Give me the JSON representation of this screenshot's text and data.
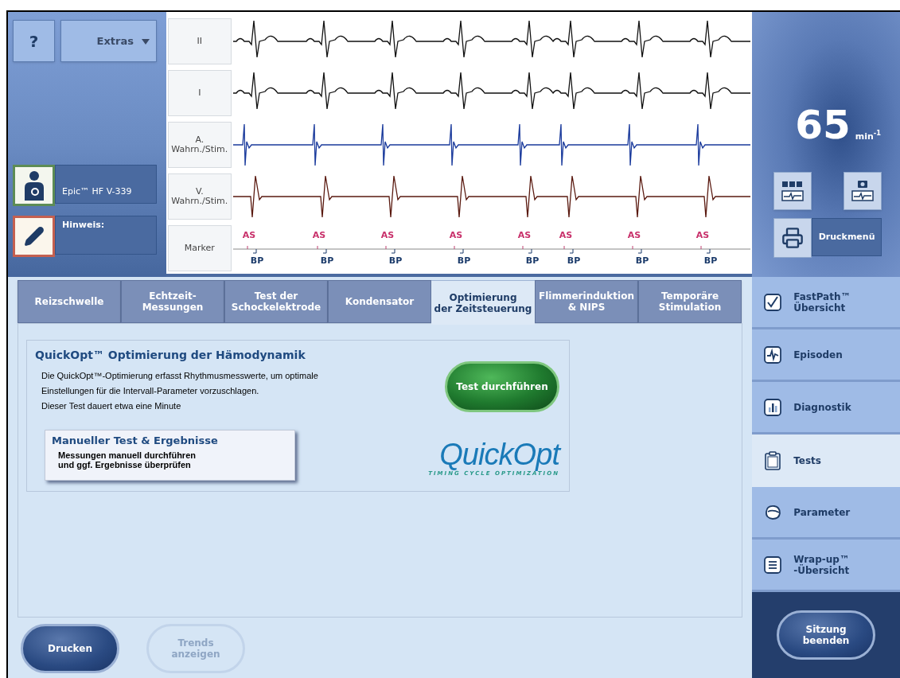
{
  "toolbar": {
    "help": "?",
    "extras": "Extras"
  },
  "device": {
    "name": "Epic™ HF V-339"
  },
  "note": {
    "label": "Hinweis:"
  },
  "ecg": {
    "lanes": [
      {
        "label": "II",
        "kind": "surface"
      },
      {
        "label": "I",
        "kind": "surface"
      },
      {
        "label": "A. Wahrn./Stim.",
        "kind": "atrial"
      },
      {
        "label": "V. Wahrn./Stim.",
        "kind": "ventricular"
      },
      {
        "label": "Marker",
        "kind": "marker"
      }
    ],
    "markers": [
      {
        "top": "AS",
        "bottom": "BP"
      },
      {
        "top": "AS",
        "bottom": "BP"
      },
      {
        "top": "AS",
        "bottom": "BP"
      },
      {
        "top": "AS",
        "bottom": "BP"
      },
      {
        "top": "AS",
        "bottom": "BP"
      },
      {
        "top": "AS",
        "bottom": "BP"
      },
      {
        "top": "AS",
        "bottom": "BP"
      },
      {
        "top": "AS",
        "bottom": "BP"
      }
    ]
  },
  "heart_rate": {
    "value": "65",
    "unit": "min$^{-1}$"
  },
  "print_menu": "Druckmenü",
  "tabs": [
    {
      "label": "Reizschwelle",
      "selected": false
    },
    {
      "label": "Echtzeit-\nMessungen",
      "selected": false
    },
    {
      "label": "Test der\nSchockelektrode",
      "selected": false
    },
    {
      "label": "Kondensator",
      "selected": false
    },
    {
      "label": "Optimierung\nder Zeitsteuerung",
      "selected": true
    },
    {
      "label": "Flimmerinduktion\n& NIPS",
      "selected": false
    },
    {
      "label": "Temporäre\nStimulation",
      "selected": false
    }
  ],
  "quickopt": {
    "title": "QuickOpt™ Optimierung der Hämodynamik",
    "description": [
      "Die QuickOpt™-Optimierung erfasst Rhythmusmesswerte, um optimale",
      "Einstellungen für die Intervall-Parameter vorzuschlagen.",
      "Dieser Test dauert etwa eine Minute"
    ],
    "run_button": "Test durchführen",
    "manual": {
      "title": "Manueller Test & Ergebnisse",
      "text": "Messungen manuell durchführen\nund ggf. Ergebnisse überprüfen"
    },
    "logo": {
      "name": "QuickOpt",
      "tagline": "TIMING CYCLE OPTIMIZATION"
    }
  },
  "bottom_buttons": [
    {
      "label": "Drucken",
      "disabled": false
    },
    {
      "label": "Trends\nanzeigen",
      "disabled": true
    }
  ],
  "nav": [
    {
      "label": "FastPath™\nÜbersicht",
      "kind": "check",
      "selected": false
    },
    {
      "label": "Episoden",
      "kind": "pulse",
      "selected": false
    },
    {
      "label": "Diagnostik",
      "kind": "bars",
      "selected": false
    },
    {
      "label": "Tests",
      "kind": "clipboard",
      "selected": true
    },
    {
      "label": "Parameter",
      "kind": "device",
      "selected": false
    },
    {
      "label": "Wrap-up™\n-Übersicht",
      "kind": "list",
      "selected": false
    }
  ],
  "end_session": "Sitzung\nbeenden"
}
